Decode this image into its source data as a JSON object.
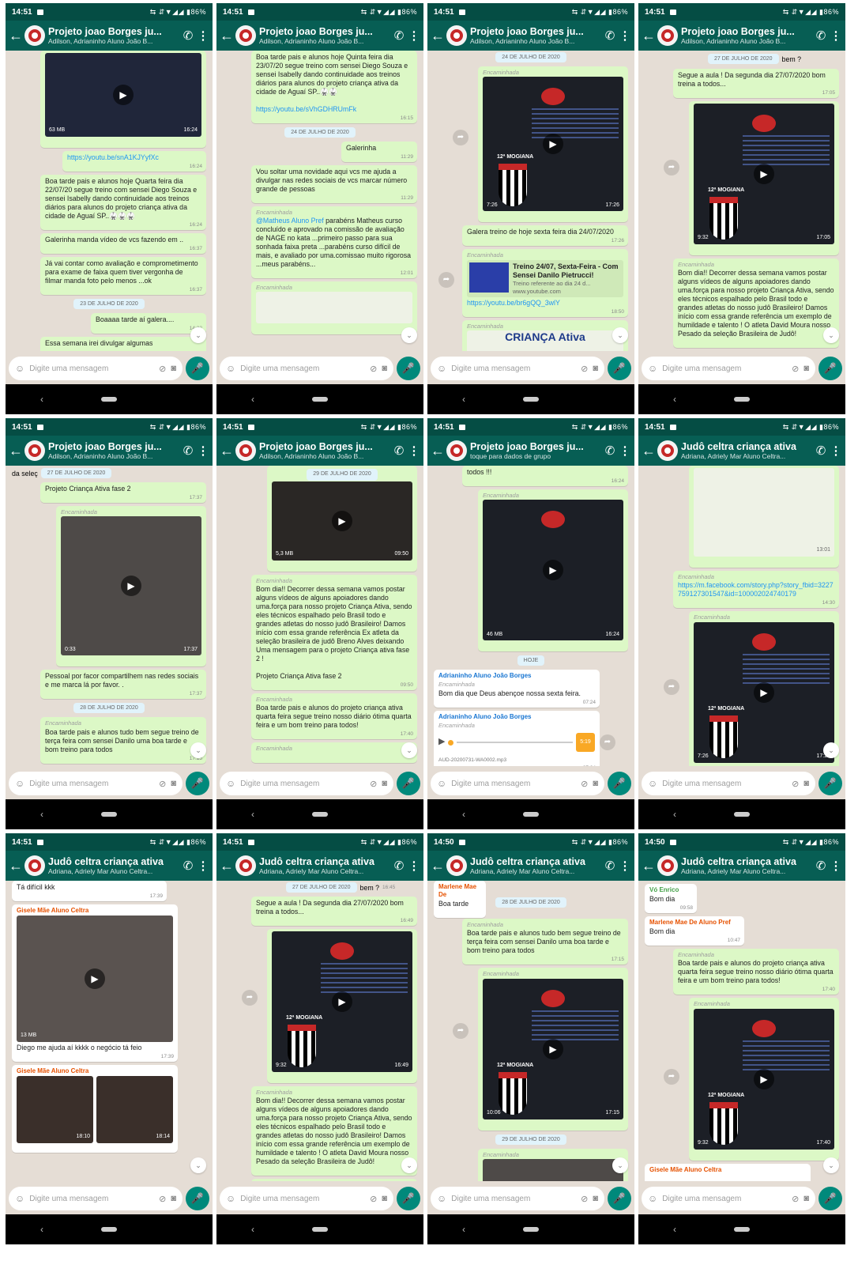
{
  "status": {
    "time_a": "14:51",
    "time_b": "14:50",
    "indicators": "⇆ ⇵▼◢◢ ▮86%"
  },
  "chat_a": {
    "title": "Projeto joao Borges ju...",
    "subtitle": "Adilson, Adrianinho Aluno João B...",
    "subtitle_alt": "toque para dados de grupo"
  },
  "chat_b": {
    "title": "Judô celtra criança ativa",
    "subtitle": "Adriana, Adriely Mar Aluno Celtra..."
  },
  "common": {
    "placeholder": "Digite uma mensagem",
    "forwarded": "Encaminhada",
    "today": "HOJE"
  },
  "dates": {
    "d22": "22 DE JULHO DE 2020",
    "d23": "23 DE JULHO DE 2020",
    "d24": "24 DE JULHO DE 2020",
    "d27": "27 DE JULHO DE 2020",
    "d28": "28 DE JULHO DE 2020",
    "d29": "29 DE JULHO DE 2020"
  },
  "msgs": {
    "video63": "63 MB",
    "t1624": "16:24",
    "t1615": "16:15",
    "t1637": "16:37",
    "t1432": "14:32",
    "t1129": "11:29",
    "t1201": "12:01",
    "t1726": "17:26",
    "t1850": "18:50",
    "t1705": "17:05",
    "t1737": "17:37",
    "t1715": "17:15",
    "t0950": "09:50",
    "t1740": "17:40",
    "t0724": "07:24",
    "t1430": "14:30",
    "t1724": "17:24",
    "t1739": "17:39",
    "t1810": "18:10",
    "t1814": "18:14",
    "t1645": "16:45",
    "t1649": "16:49",
    "t1737b": "17:37",
    "t0958": "09:58",
    "t1047": "10:47",
    "t1301": "13:01",
    "link_snA": "https://youtu.be/snA1KJYyfXc",
    "quarta": "Boa tarde pais e alunos hoje Quarta feira dia 22/07/20 segue treino com sensei Diego Souza e sensei Isabelly dando continuidade aos treinos diários para alunos do projeto criança ativa da cidade de Aguaí SP..🥋🥋🥋",
    "galerinha_video": "Galerinha manda vídeo de vcs fazendo em ..",
    "avaliacao": "Já vai contar como avaliação e comprometimento para exame de faixa quem tiver vergonha de filmar manda foto pelo menos ...ok",
    "boaaaa": "Boaaaa tarde aí galera....",
    "semana": "Essa semana irei divulgar algumas",
    "quinta": "Boa tarde pais e alunos hoje Quinta feira dia 23/07/20 segue treino com sensei Diego Souza e sensei Isabelly dando continuidade aos treinos diários para alunos do projeto criança ativa da cidade de Aguaí SP..🥋🥋",
    "link_sVh": "https://youtu.be/sVhGDHRUmFk",
    "galerinha": "Galerinha",
    "novidade": "Vou soltar uma novidade aqui vcs me ajuda a divulgar nas redes sociais de vcs marcar número grande de pessoas",
    "mention": "@Matheus Aluno Pref",
    "parabens": " parabéns Matheus curso concluído e aprovado na comissão de avaliação de NAGE no kata ...primeiro passo para sua sonhada faixa preta ...parabéns curso difícil de mais, e avaliado por uma.comissao muito rigorosa ...meus parabéns...",
    "dur726": "7:26",
    "dur932": "9:32",
    "dur033": "0:33",
    "dur1006": "10:06",
    "mb53": "5,3 MB",
    "mb46": "46 MB",
    "mb13": "13 MB",
    "galera_treino": "Galera treino de hoje sexta feira dia 24/07/2020",
    "yt_title": "Treino 24/07, Sexta-Feira - Com Sensei Danilo Pietrucci!",
    "yt_desc": "Treino referente ao dia 24 d...",
    "yt_site": "www.youtube.com",
    "link_br6": "https://youtu.be/br6gQQ_3wlY",
    "crianca_ativa": "CRIANÇA Ativa",
    "bem": "bem ?",
    "segue_aula": "Segue a aula ! Da segunda dia 27/07/2020 bom treina a todos...",
    "bom_dia_long": "Bom dia!! Decorrer dessa semana vamos postar alguns vídeos de alguns apoiadores dando uma.força para nosso projeto Criança Ativa, sendo eles técnicos espalhado pelo Brasil todo e grandes atletas do nosso judô Brasileiro! Damos início com essa grande referência um exemplo de humildade e talento ! O atleta David Moura nosso Pesado da seleção Brasileira de Judô!",
    "projeto_fase2": "Projeto Criança Ativa fase 2",
    "da_selec": "da seleç",
    "compartilhem": "Pessoal por facor compartilhem nas redes sociais e me marca lá por favor. .",
    "terca": "Boa tarde pais e alunos tudo bem segue treino de terça feira com sensei Danilo uma boa tarde e bom treino para todos",
    "breno": "Bom dia!! Decorrer dessa semana vamos postar alguns vídeos de alguns apoiadores dando uma.força para nosso projeto Criança Ativa, sendo eles técnicos espalhado pelo Brasil todo e grandes atletas do nosso judô Brasileiro! Damos início com essa grande referência Ex atleta da seleção brasileira de judô Breno Alves deixando Uma mensagem para o projeto Criança ativa fase 2 !",
    "quarta2": "Boa tarde pais e alunos do projeto criança ativa quarta feira segue treino nosso diário ótima quarta feira e um bom treino para todos!",
    "todos": "todos !!!",
    "adrianinho": "Adrianinho Aluno João Borges",
    "bom_dia_deus": "Bom dia que Deus abençoe nossa sexta feira.",
    "audio_name": "AUD-20200731-WA0002.mp3",
    "audio_len": "5:19",
    "fb_link": "https://m.facebook.com/story.php?story_fbid=3227759127301547&id=100002024740179",
    "ta_dificil": "Tá difícil kkk",
    "gisele": "Gisele Mãe Aluno Celtra",
    "diego_ajuda": "Diego me ajuda aí kkkk o negócio tá feio",
    "marlene": "Marlene Mae De",
    "marlene_full": "Marlene Mae De Aluno Pref",
    "boa_tarde": "Boa tarde",
    "vo_enrico": "Vó Enrico",
    "bom_dia": "Bom dia",
    "mogiana": "12ª MOGIANA",
    "fpjudo": "F.P.JUDÔ"
  }
}
